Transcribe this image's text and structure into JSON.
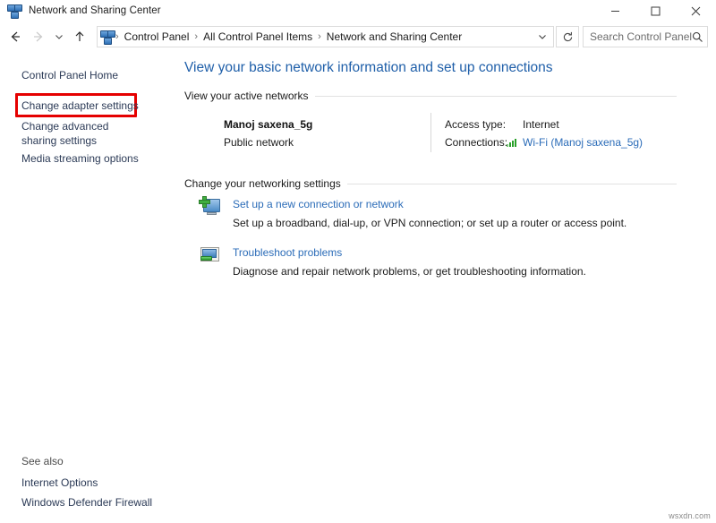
{
  "window": {
    "title": "Network and Sharing Center",
    "icon": "network-icon",
    "controls": {
      "minimize": "–",
      "maximize": "□",
      "close": "✕"
    }
  },
  "addressbar": {
    "back": "←",
    "forward": "→",
    "recent": "⌄",
    "up": "↑",
    "breadcrumb": [
      "Control Panel",
      "All Control Panel Items",
      "Network and Sharing Center"
    ],
    "separator": "›",
    "dropdown": "⌄",
    "refresh": "↻",
    "search": {
      "placeholder": "Search Control Panel",
      "value": "",
      "icon": "search-icon"
    }
  },
  "sidebar": {
    "home": "Control Panel Home",
    "links": [
      "Change adapter settings",
      "Change advanced sharing settings",
      "Media streaming options"
    ],
    "highlighted": "Change adapter settings",
    "highlight_color": "#e50000",
    "see_also": {
      "heading": "See also",
      "links": [
        "Internet Options",
        "Windows Defender Firewall"
      ]
    }
  },
  "main": {
    "page_title": "View your basic network information and set up connections",
    "title_color": "#1f5fa9",
    "sections": {
      "active_networks": "View your active networks",
      "networking_settings": "Change your networking settings"
    },
    "active_network": {
      "name": "Manoj saxena_5g",
      "type": "Public network",
      "access_type_label": "Access type:",
      "access_type_value": "Internet",
      "connections_label": "Connections:",
      "connections_link": "Wi-Fi (Manoj saxena_5g)",
      "connections_icon": "wifi-signal-icon"
    },
    "tasks": [
      {
        "icon": "new-connection-icon",
        "link": "Set up a new connection or network",
        "description": "Set up a broadband, dial-up, or VPN connection; or set up a router or access point."
      },
      {
        "icon": "troubleshoot-icon",
        "link": "Troubleshoot problems",
        "description": "Diagnose and repair network problems, or get troubleshooting information."
      }
    ],
    "link_color": "#2b6cb8"
  },
  "watermark": "wsxdn.com"
}
